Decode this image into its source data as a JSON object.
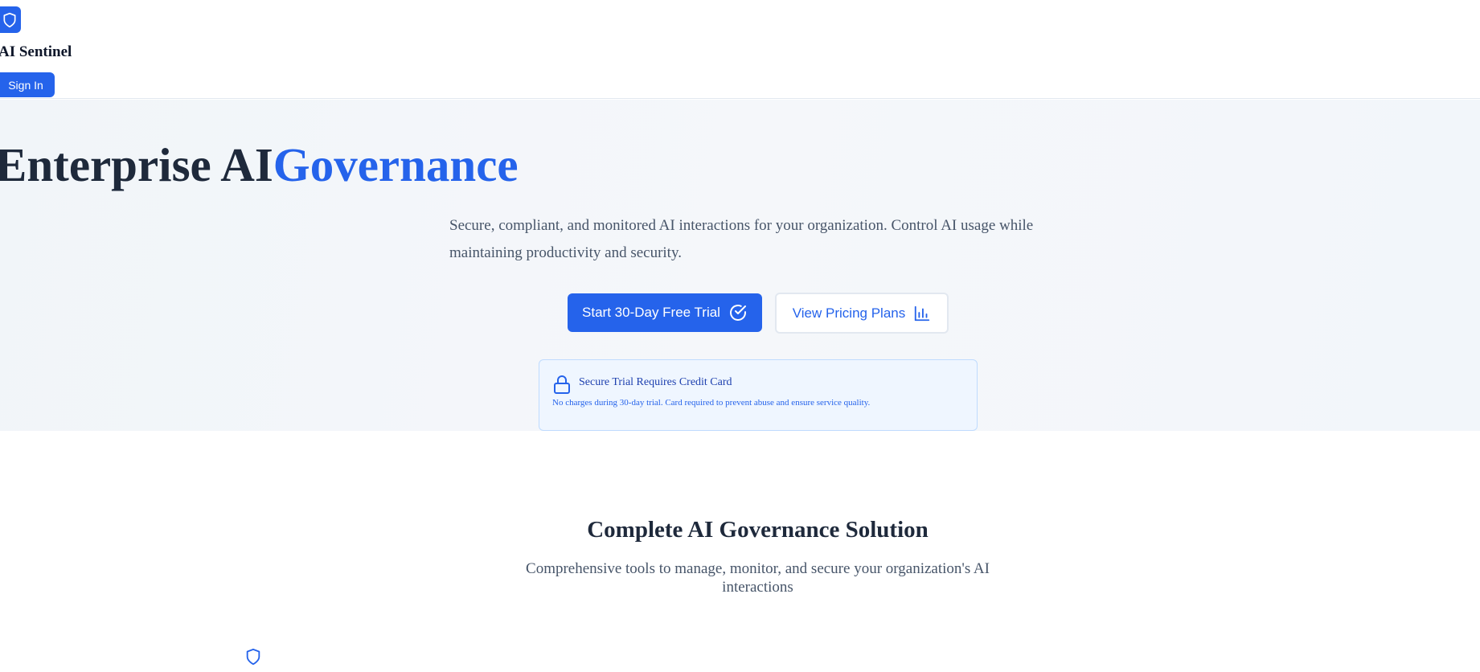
{
  "header": {
    "brand": "AI Sentinel",
    "logo_icon": "shield-icon",
    "sign_in_label": "Sign In"
  },
  "hero": {
    "title_main": "Enterprise AI",
    "title_accent": "Governance",
    "subtitle": "Secure, compliant, and monitored AI interactions for your organization. Control AI usage while maintaining productivity and security.",
    "primary_cta": "Start 30-Day Free Trial",
    "primary_cta_icon": "check-circle-icon",
    "secondary_cta": "View Pricing Plans",
    "secondary_cta_icon": "bar-chart-icon",
    "notice": {
      "icon": "lock-icon",
      "title": "Secure Trial Requires Credit Card",
      "text": "No charges during 30-day trial. Card required to prevent abuse and ensure service quality."
    }
  },
  "features": {
    "title": "Complete AI Governance Solution",
    "subtitle": "Comprehensive tools to manage, monitor, and secure your organization's AI interactions",
    "first_icon": "shield-icon"
  },
  "colors": {
    "accent": "#2563eb",
    "heading": "#1e293b",
    "body_text": "#475569",
    "notice_bg": "#eff6ff"
  }
}
